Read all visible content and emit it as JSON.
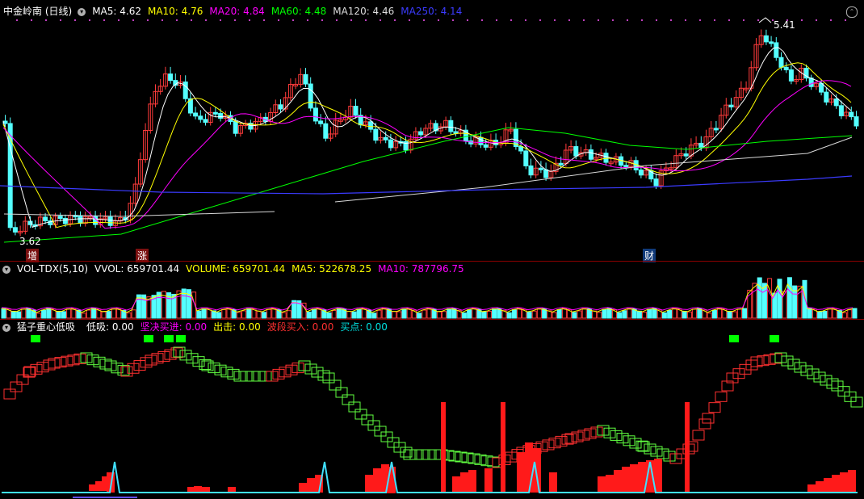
{
  "main": {
    "title": "中金岭南 (日线)",
    "ma": [
      {
        "label": "MA5: 4.62",
        "color": "#ffffff"
      },
      {
        "label": "MA10: 4.76",
        "color": "#ffff00"
      },
      {
        "label": "MA20: 4.84",
        "color": "#ff00ff"
      },
      {
        "label": "MA60: 4.48",
        "color": "#00ff00"
      },
      {
        "label": "MA120: 4.46",
        "color": "#d8d8d8"
      },
      {
        "label": "MA250: 4.14",
        "color": "#3b3bff"
      }
    ],
    "high_label": "5.41",
    "low_label": "3.62",
    "markers": [
      {
        "text": "增",
        "color": "#ffffff"
      },
      {
        "text": "涨",
        "color": "#ffffff"
      },
      {
        "text": "财",
        "color": "#ffffff"
      }
    ]
  },
  "volume": {
    "name": "VOL-TDX(5,10)",
    "items": [
      {
        "label": "VVOL: 659701.44",
        "color": "#ffffff"
      },
      {
        "label": "VOLUME: 659701.44",
        "color": "#ffff00"
      },
      {
        "label": "MA5: 522678.25",
        "color": "#ffff00"
      },
      {
        "label": "MA10: 787796.75",
        "color": "#ff00ff"
      }
    ]
  },
  "indicator": {
    "name": "猛子重心低吸",
    "items": [
      {
        "label": "低吸: 0.00",
        "color": "#ffffff"
      },
      {
        "label": "坚决买进: 0.00",
        "color": "#ff00ff"
      },
      {
        "label": "出击: 0.00",
        "color": "#ffff00"
      },
      {
        "label": "波段买入: 0.00",
        "color": "#ff3030"
      },
      {
        "label": "买点: 0.00",
        "color": "#00e0e0"
      }
    ]
  },
  "colors": {
    "up": "#ff3b3b",
    "down": "#54ffff",
    "ma5": "#ffffff",
    "ma10": "#ffff00",
    "ma20": "#ff00ff",
    "ma60": "#00ff00",
    "ma120": "#d8d8d8",
    "ma250": "#3b3bff"
  }
}
